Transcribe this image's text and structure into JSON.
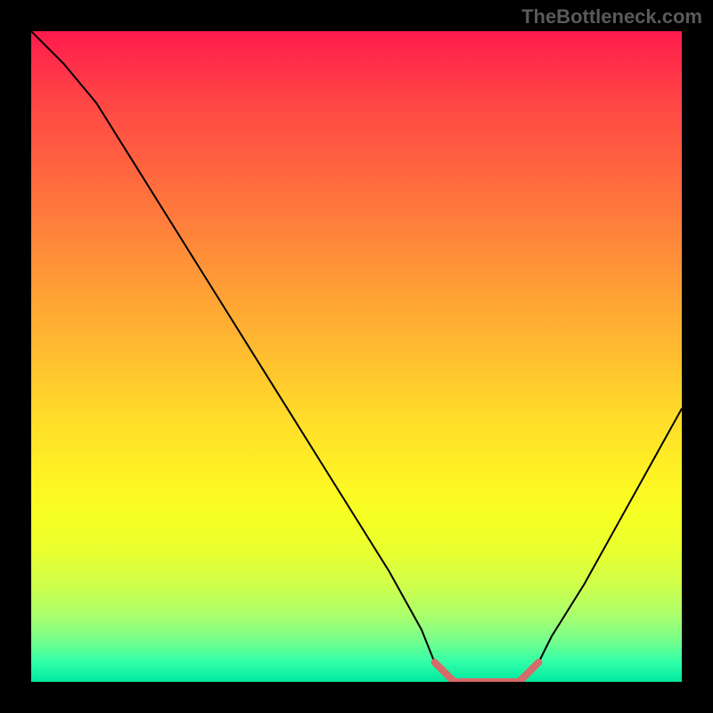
{
  "watermark": "TheBottleneck.com",
  "chart_data": {
    "type": "line",
    "title": "",
    "xlabel": "",
    "ylabel": "",
    "xlim": [
      0,
      100
    ],
    "ylim": [
      0,
      100
    ],
    "grid": false,
    "legend": false,
    "series": [
      {
        "name": "bottleneck-curve",
        "x": [
          0,
          5,
          10,
          15,
          20,
          25,
          30,
          35,
          40,
          45,
          50,
          55,
          60,
          62,
          65,
          70,
          75,
          78,
          80,
          85,
          90,
          95,
          100
        ],
        "y": [
          100,
          95,
          89,
          81,
          73,
          65,
          57,
          49,
          41,
          33,
          25,
          17,
          8,
          3,
          0,
          0,
          0,
          3,
          7,
          15,
          24,
          33,
          42
        ],
        "color": "#000000"
      },
      {
        "name": "optimal-zone",
        "x": [
          62,
          65,
          70,
          75,
          78
        ],
        "y": [
          3,
          0,
          0,
          0,
          3
        ],
        "color": "#d86a6a"
      }
    ],
    "gradient_stops": [
      {
        "pos": 0,
        "color": "#ff1a4d"
      },
      {
        "pos": 50,
        "color": "#ffc52e"
      },
      {
        "pos": 75,
        "color": "#f7ff22"
      },
      {
        "pos": 100,
        "color": "#00e8a0"
      }
    ]
  }
}
